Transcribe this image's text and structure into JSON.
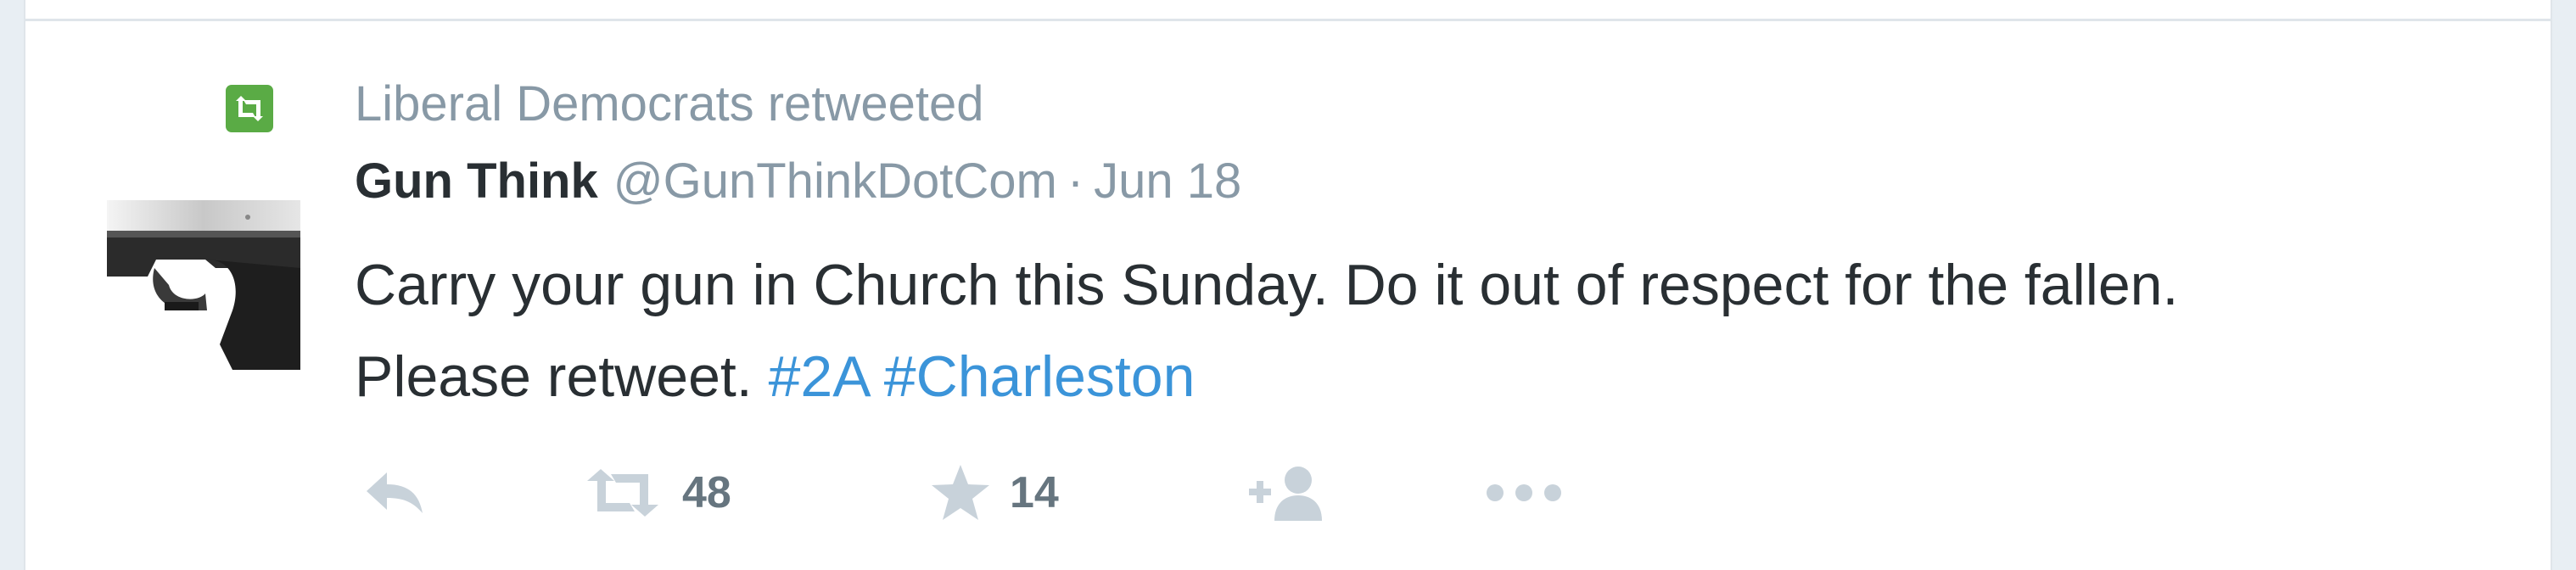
{
  "tweet": {
    "context_label": "Liberal Democrats retweeted",
    "author": {
      "fullname": "Gun Think",
      "username": "@GunThinkDotCom",
      "separator": "·",
      "time": "Jun 18"
    },
    "text": {
      "line1": "Carry your gun in Church this Sunday.  Do it out of respect for the fallen.",
      "line2_prefix": "Please retweet.",
      "hashtags": [
        "#2A",
        "#Charleston"
      ]
    },
    "actions": {
      "retweet_count": "48",
      "favorite_count": "14"
    },
    "icons": {
      "context": "retweet-icon",
      "reply": "reply-icon",
      "retweet": "retweet-icon",
      "favorite": "star-icon",
      "follow": "add-user-icon",
      "more": "more-icon"
    },
    "colors": {
      "retweet_badge": "#5aab45",
      "hashtag": "#3b94d9",
      "muted": "#8899a6",
      "text": "#292f33"
    }
  }
}
